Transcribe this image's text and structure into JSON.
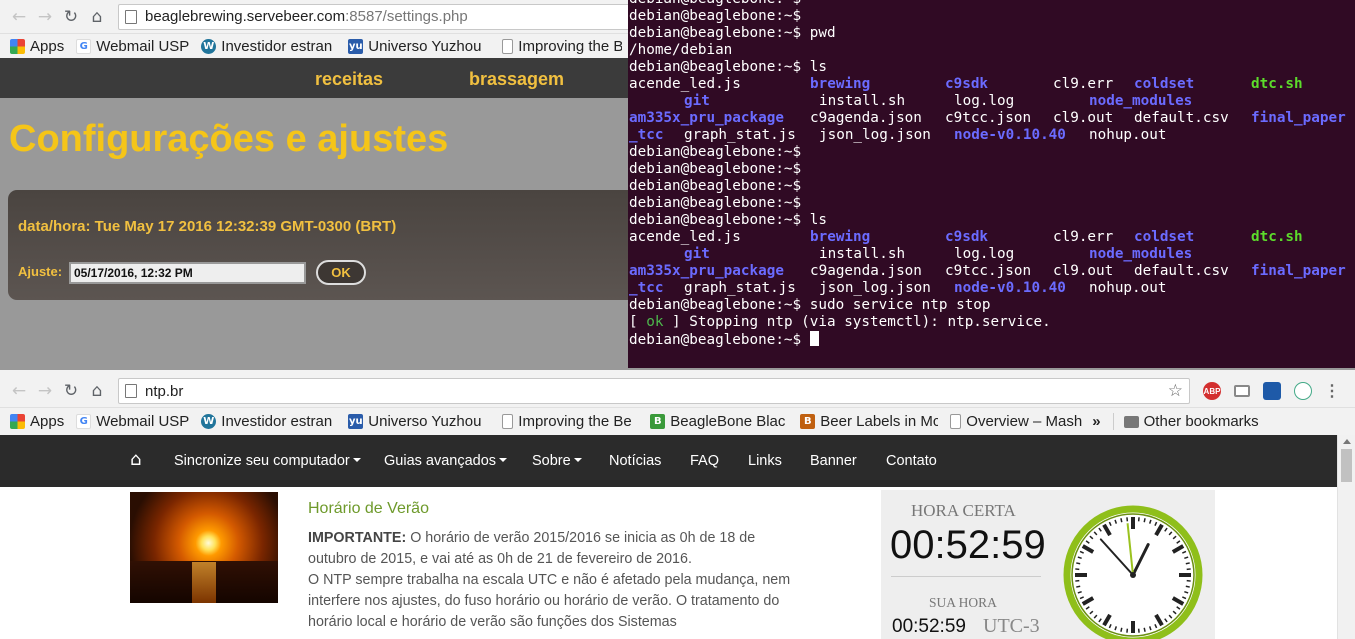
{
  "top_browser": {
    "url_host": "beaglebrewing.servebeer.com",
    "url_rest": ":8587/settings.php",
    "bookmarks": [
      "Apps",
      "Webmail USP",
      "Investidor estran",
      "Universo Yuzhou",
      "Improving the B"
    ],
    "page": {
      "nav": [
        "receitas",
        "brassagem"
      ],
      "title": "Configurações e ajustes",
      "datetime_label": "data/hora: Tue May 17 2016 12:32:39 GMT-0300 (BRT)",
      "adjust_label": "Ajuste:",
      "adjust_value": "05/17/2016, 12:32  PM",
      "ok_label": "OK"
    }
  },
  "terminal": {
    "prompt": "debian@beaglebone:~$",
    "cmd_pwd": " pwd",
    "pwd_output": "/home/debian",
    "cmd_ls": " ls",
    "cmd_ntp": " sudo service ntp stop",
    "ls_row1": {
      "acende_led": "acende_led.js",
      "brewing": "brewing",
      "c9sdk": "c9sdk",
      "cl9err": "cl9.err",
      "coldset": "coldset",
      "dtc": "dtc.sh"
    },
    "ls_row2": {
      "git": "git",
      "install": "install.sh",
      "log": "log.log",
      "node_modules": "node_modules"
    },
    "ls_row3": {
      "am335x": "am335x_pru_package",
      "c9agenda": "c9agenda.json",
      "c9tcc": "c9tcc.json",
      "cl9out": "cl9.out",
      "default": "default.csv",
      "final_paper": "final_paper"
    },
    "ls_row4": {
      "tcc": "_tcc",
      "graph_stat": "graph_stat.js",
      "json_log": "json_log.json",
      "node_v": "node-v0.10.40",
      "nohup": "nohup.out"
    },
    "ntp_bracket_open": "[ ",
    "ntp_ok": "ok",
    "ntp_message": " ] Stopping ntp (via systemctl): ntp.service."
  },
  "bottom_browser": {
    "url": "ntp.br",
    "bookmarks": [
      "Apps",
      "Webmail USP",
      "Investidor estran",
      "Universo Yuzhou",
      "Improving the Be",
      "BeagleBone Blac",
      "Beer Labels in Mc",
      "Overview – Mash"
    ],
    "bookmarks_overflow": "»",
    "other_bookmarks": "Other bookmarks",
    "extension_abp": "ABP",
    "nav": {
      "sync": "Sincronize seu computador",
      "guides": "Guias avançados",
      "about": "Sobre",
      "news": "Notícias",
      "faq": "FAQ",
      "links": "Links",
      "banner": "Banner",
      "contact": "Contato"
    },
    "article": {
      "title": "Horário de Verão",
      "important": "IMPORTANTE:",
      "p1": " O horário de verão 2015/2016 se inicia as 0h de 18 de outubro de 2015, e vai até as 0h de 21 de fevereiro de 2016.",
      "p2": "O NTP sempre trabalha na escala UTC e não é afetado pela mudança, nem interfere nos ajustes, do fuso horário ou horário de verão. O tratamento do horário local e horário de verão são funções dos Sistemas"
    },
    "clock": {
      "hora_certa_label": "HORA CERTA",
      "hora_certa": "00:52:59",
      "sua_hora_label": "SUA HORA",
      "sua_hora": "00:52:59",
      "utc": "UTC-3",
      "analog_hour": 0,
      "analog_minute": 52,
      "analog_second": 59
    }
  },
  "colors": {
    "terminal_bg": "#300a24",
    "terminal_dir": "#6b6bff",
    "terminal_exec": "#5cdc2b",
    "beagle_accent": "#f5c518",
    "ntp_green": "#6e9a2b",
    "clock_ring": "#8fbf1a"
  }
}
